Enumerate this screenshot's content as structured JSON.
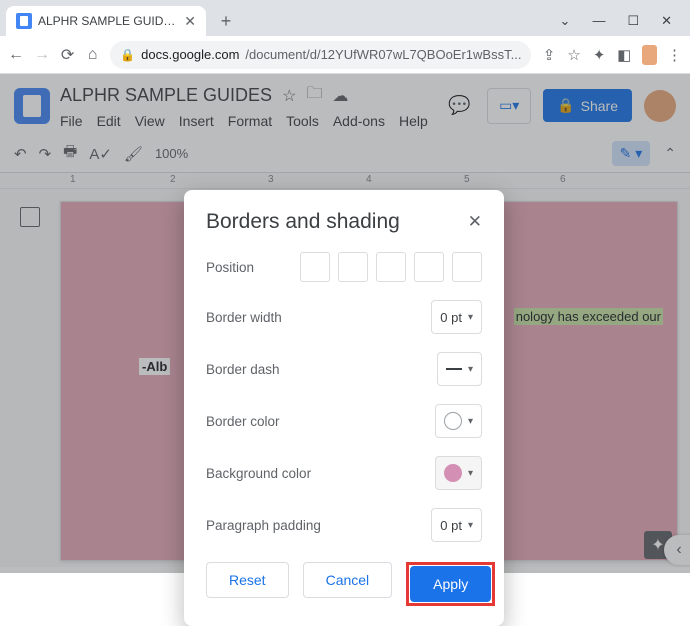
{
  "browser": {
    "tab_title": "ALPHR SAMPLE GUIDES - Googl",
    "url_host": "docs.google.com",
    "url_path": "/document/d/12YUfWR07wL7QBOoEr1wBssT..."
  },
  "docs": {
    "title": "ALPHR SAMPLE GUIDES",
    "menu": {
      "file": "File",
      "edit": "Edit",
      "view": "View",
      "insert": "Insert",
      "format": "Format",
      "tools": "Tools",
      "addons": "Add-ons",
      "help": "Help"
    },
    "share_label": "Share",
    "zoom": "100%",
    "ruler": {
      "m1": "1",
      "m2": "2",
      "m3": "3",
      "m4": "4",
      "m5": "5",
      "m6": "6"
    },
    "content_right": "nology has exceeded our",
    "content_left": "-Alb"
  },
  "dialog": {
    "title": "Borders and shading",
    "labels": {
      "position": "Position",
      "border_width": "Border width",
      "border_dash": "Border dash",
      "border_color": "Border color",
      "background_color": "Background color",
      "paragraph_padding": "Paragraph padding"
    },
    "border_width_value": "0 pt",
    "paragraph_padding_value": "0 pt",
    "bg_color": "#d48fb4",
    "actions": {
      "reset": "Reset",
      "cancel": "Cancel",
      "apply": "Apply"
    }
  }
}
